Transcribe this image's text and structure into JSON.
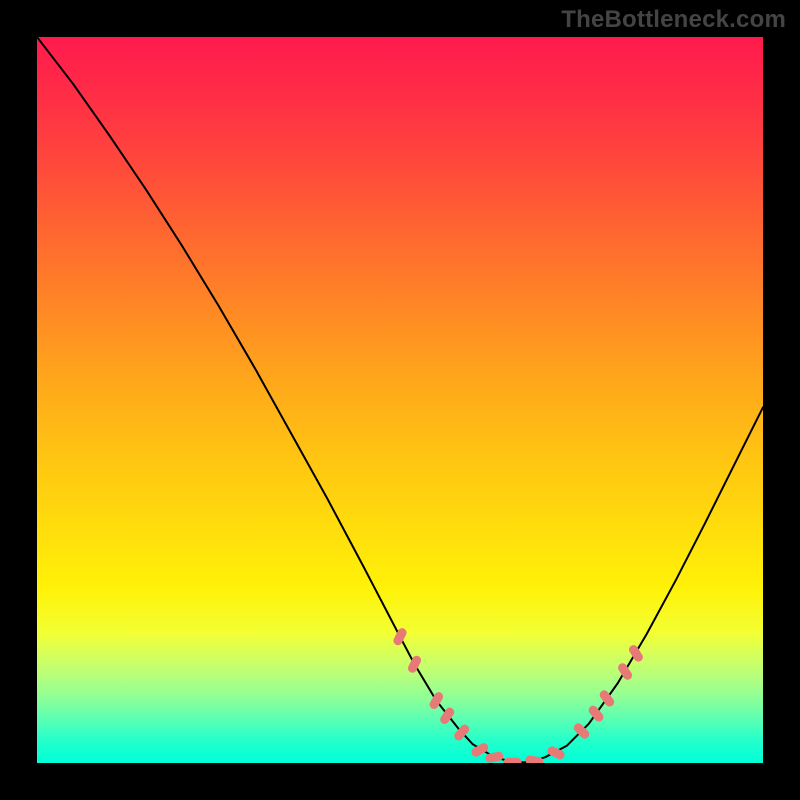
{
  "watermark": "TheBottleneck.com",
  "chart_data": {
    "type": "line",
    "title": "",
    "xlabel": "",
    "ylabel": "",
    "xlim": [
      0,
      100
    ],
    "ylim": [
      0,
      100
    ],
    "grid": false,
    "legend": false,
    "series": [
      {
        "name": "curve",
        "x": [
          0,
          5,
          10,
          15,
          20,
          25,
          30,
          35,
          40,
          45,
          50,
          52,
          55,
          58,
          60,
          63,
          66,
          68,
          70,
          73,
          76,
          80,
          84,
          88,
          92,
          96,
          100
        ],
        "y": [
          100,
          93.5,
          86.4,
          79.0,
          71.2,
          63.0,
          54.4,
          45.4,
          36.4,
          27.0,
          17.4,
          13.6,
          8.6,
          4.8,
          2.6,
          0.8,
          0.0,
          0.2,
          0.8,
          2.4,
          5.4,
          11.0,
          17.8,
          25.2,
          33.0,
          41.0,
          49.0
        ]
      }
    ],
    "markers": {
      "name": "highlighted-points",
      "color": "#e77a76",
      "shape": "pill",
      "points": [
        {
          "x": 50,
          "y": 17.4,
          "angle": -63
        },
        {
          "x": 52,
          "y": 13.6,
          "angle": -63
        },
        {
          "x": 55,
          "y": 8.6,
          "angle": -60
        },
        {
          "x": 56.5,
          "y": 6.5,
          "angle": -56
        },
        {
          "x": 58.5,
          "y": 4.2,
          "angle": -48
        },
        {
          "x": 61,
          "y": 1.8,
          "angle": -30
        },
        {
          "x": 63,
          "y": 0.8,
          "angle": -12
        },
        {
          "x": 65.5,
          "y": 0.1,
          "angle": 0
        },
        {
          "x": 68.5,
          "y": 0.3,
          "angle": 10
        },
        {
          "x": 71.5,
          "y": 1.4,
          "angle": 25
        },
        {
          "x": 75,
          "y": 4.4,
          "angle": 45
        },
        {
          "x": 77,
          "y": 6.8,
          "angle": 50
        },
        {
          "x": 78.5,
          "y": 8.9,
          "angle": 53
        },
        {
          "x": 81,
          "y": 12.6,
          "angle": 56
        },
        {
          "x": 82.5,
          "y": 15.1,
          "angle": 57
        }
      ]
    }
  }
}
